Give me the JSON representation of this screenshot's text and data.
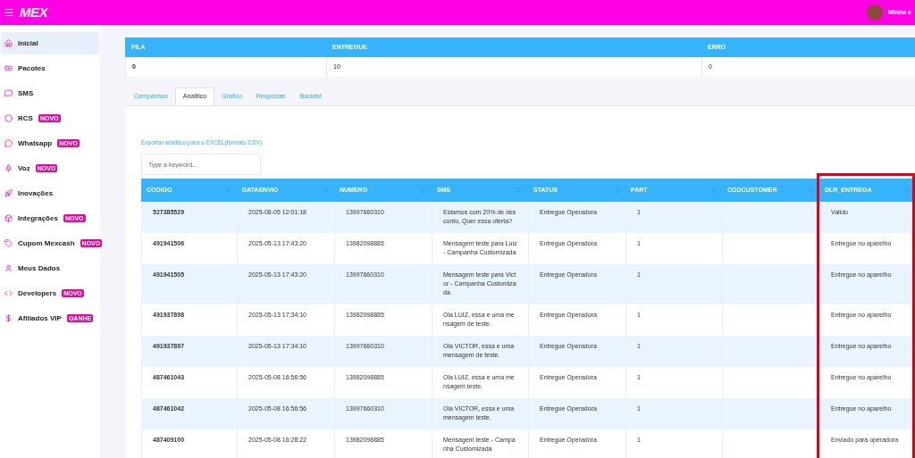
{
  "topbar": {
    "logo": "MEX",
    "user_label": "Minha c"
  },
  "sidebar": {
    "items": [
      {
        "label": "Inicial",
        "selected": true
      },
      {
        "label": "Pacotes",
        "selected": false
      },
      {
        "label": "SMS",
        "selected": false
      },
      {
        "label": "RCS",
        "selected": false,
        "badge": "NOVO"
      },
      {
        "label": "Whatsapp",
        "selected": false,
        "badge": "NOVO"
      },
      {
        "label": "Voz",
        "selected": false,
        "badge": "NOVO"
      },
      {
        "label": "Inovações",
        "selected": false
      },
      {
        "label": "Integrações",
        "selected": false,
        "badge": "NOVO"
      },
      {
        "label": "Cupom Mexcash",
        "selected": false,
        "badge": "NOVO"
      },
      {
        "label": "Meus Dados",
        "selected": false
      },
      {
        "label": "Developers",
        "selected": false,
        "badge": "NOVO"
      },
      {
        "label": "Afiliados VIP",
        "selected": false,
        "badge": "GANHE"
      }
    ]
  },
  "summary": {
    "columns": [
      "FILA",
      "ENTREGUE",
      "ERRO"
    ],
    "values": [
      "0",
      "10",
      "0"
    ]
  },
  "tabs": [
    {
      "label": "Campanhas",
      "selected": false
    },
    {
      "label": "Analitico",
      "selected": true
    },
    {
      "label": "Gráfico",
      "selected": false
    },
    {
      "label": "Respostas",
      "selected": false
    },
    {
      "label": "Backlist",
      "selected": false
    }
  ],
  "export_link": "Exportar analitico para o EXCEL(formato CSV)",
  "search": {
    "placeholder": "Type a keyword..."
  },
  "table": {
    "columns": [
      {
        "label": "CODIGO",
        "highlighted": false
      },
      {
        "label": "DATAENVIO",
        "highlighted": false
      },
      {
        "label": "NUMERO",
        "highlighted": false
      },
      {
        "label": "SMS",
        "highlighted": false
      },
      {
        "label": "STATUS",
        "highlighted": false
      },
      {
        "label": "PART",
        "highlighted": false
      },
      {
        "label": "CODCUSTOMER",
        "highlighted": false
      },
      {
        "label": "DLR_ENTREGA",
        "highlighted": true
      }
    ],
    "rows": [
      [
        "527385529",
        "2025-08-05 12:01:18",
        "13997660310",
        "Estamos com 20% de desconto, Quer essa oferta?",
        "Entregue Operadora",
        "1",
        "",
        "Valido"
      ],
      [
        "491941506",
        "2025-05-13 17:43:20",
        "13982098885",
        "Mensagem teste para Luiz - Campanha Customizada",
        "Entregue Operadora",
        "1",
        "",
        "Entregue no aparelho"
      ],
      [
        "491941505",
        "2025-05-13 17:43:20",
        "13997660310",
        "Mensagem teste para Victor - Campanha Customizada",
        "Entregue Operadora",
        "1",
        "",
        "Entregue no aparelho"
      ],
      [
        "491937898",
        "2025-05-13 17:34:10",
        "13982098885",
        "Ola LUIZ, essa e uma mensagem de teste.",
        "Entregue Operadora",
        "1",
        "",
        "Entregue no aparelho"
      ],
      [
        "491937897",
        "2025-05-13 17:34:10",
        "13997660310",
        "Ola VICTOR, essa e uma mensagem de teste.",
        "Entregue Operadora",
        "1",
        "",
        "Entregue no aparelho"
      ],
      [
        "487461043",
        "2025-05-08 16:56:56",
        "13982098885",
        "Ola LUIZ, essa e uma mensagem teste.",
        "Entregue Operadora",
        "1",
        "",
        "Entregue no aparelho"
      ],
      [
        "487461042",
        "2025-05-08 16:56:56",
        "13997660310",
        "Ola VICTOR, essa e uma mensagem teste.",
        "Entregue Operadora",
        "1",
        "",
        "Entregue no aparelho"
      ],
      [
        "487409100",
        "2025-05-08 16:28:22",
        "13982098885",
        "Mensagem teste - Campanha Customizada",
        "Entregue Operadora",
        "1",
        "",
        "Enviado para operadora"
      ]
    ]
  }
}
